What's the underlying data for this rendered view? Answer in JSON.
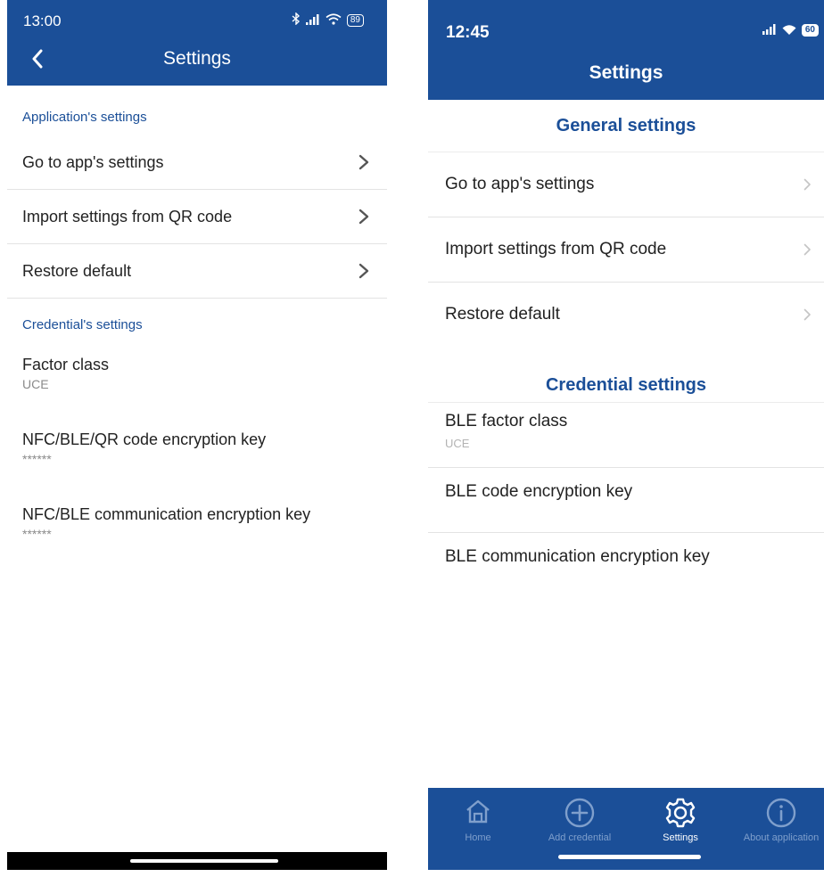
{
  "left": {
    "status_time": "13:00",
    "battery": "89",
    "title": "Settings",
    "section_app": "Application's settings",
    "nav_items": [
      {
        "label": "Go to app's settings"
      },
      {
        "label": "Import settings from QR code"
      },
      {
        "label": "Restore default"
      }
    ],
    "section_cred": "Credential's settings",
    "credential_items": [
      {
        "label": "Factor class",
        "value": "UCE"
      },
      {
        "label": "NFC/BLE/QR code encryption key",
        "value": "******"
      },
      {
        "label": "NFC/BLE communication encryption key",
        "value": "******"
      }
    ]
  },
  "right": {
    "status_time": "12:45",
    "battery": "60",
    "title": "Settings",
    "section_general": "General settings",
    "nav_items": [
      {
        "label": "Go to app's settings"
      },
      {
        "label": "Import settings from QR code"
      },
      {
        "label": "Restore default"
      }
    ],
    "section_cred": "Credential settings",
    "credential_items": [
      {
        "label": "BLE factor class",
        "value": "UCE"
      },
      {
        "label": "BLE code encryption key"
      },
      {
        "label": "BLE communication encryption key"
      }
    ],
    "tabs": [
      {
        "label": "Home",
        "icon": "home-icon"
      },
      {
        "label": "Add credential",
        "icon": "plus-circle-icon"
      },
      {
        "label": "Settings",
        "icon": "gear-icon",
        "active": true
      },
      {
        "label": "About application",
        "icon": "info-circle-icon"
      }
    ]
  },
  "colors": {
    "brand_blue": "#1b4f98",
    "inactive_tab": "#7f9fcc",
    "secondary_text": "#8a8a8a"
  }
}
